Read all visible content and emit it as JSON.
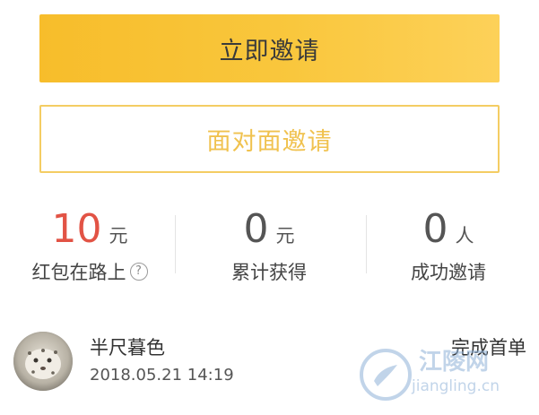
{
  "actions": {
    "invite_now": "立即邀请",
    "face_to_face": "面对面邀请"
  },
  "stats": [
    {
      "value": "10",
      "unit": "元",
      "label": "红包在路上",
      "help_icon": "question-circle-icon"
    },
    {
      "value": "0",
      "unit": "元",
      "label": "累计获得"
    },
    {
      "value": "0",
      "unit": "人",
      "label": "成功邀请"
    }
  ],
  "record": {
    "name": "半尺暮色",
    "time": "2018.05.21 14:19",
    "status": "完成首单"
  },
  "watermark": {
    "text": "江陵网",
    "url": "jiangling.cn"
  },
  "colors": {
    "primary": "#f9c73d",
    "outline": "#f4cd63",
    "highlight": "#e25345"
  }
}
